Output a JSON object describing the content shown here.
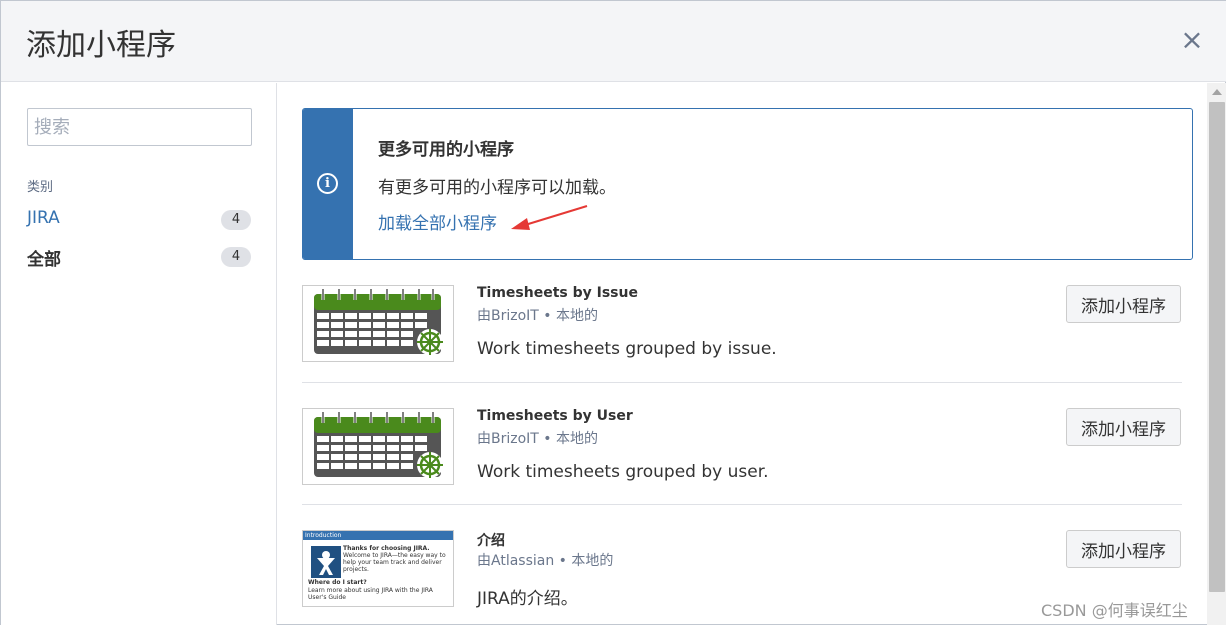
{
  "dialog": {
    "title": "添加小程序",
    "close_glyph": "×"
  },
  "sidebar": {
    "search_placeholder": "搜索",
    "category_heading": "类别",
    "categories": [
      {
        "label": "JIRA",
        "count": "4"
      },
      {
        "label": "全部",
        "count": "4"
      }
    ]
  },
  "info": {
    "icon": "info-icon",
    "title": "更多可用的小程序",
    "body": "有更多可用的小程序可以加载。",
    "link": "加载全部小程序"
  },
  "gadgets": [
    {
      "name": "Timesheets by Issue",
      "by": "由BrizoIT • 本地的",
      "description": "Work timesheets grouped by issue.",
      "button": "添加小程序",
      "thumbnail": "calendar-icon"
    },
    {
      "name": "Timesheets by User",
      "by": "由BrizoIT • 本地的",
      "description": "Work timesheets grouped by user.",
      "button": "添加小程序",
      "thumbnail": "calendar-icon"
    },
    {
      "name": "介绍",
      "by": "由Atlassian • 本地的",
      "description": "JIRA的介绍。",
      "button": "添加小程序",
      "thumbnail": "introduction-thumbnail",
      "thumb_text": {
        "bar": "Introduction",
        "line1": "Thanks for choosing JIRA.",
        "line2": "Welcome to JIRA—the easy way to help your team track and deliver projects.",
        "line3": "Where do I start?",
        "line4": "Learn more about using JIRA with the JIRA User's Guide"
      }
    }
  ],
  "colors": {
    "accent": "#3572b0",
    "calendar_green": "#4a8a1c",
    "calendar_grey": "#555555"
  },
  "watermark": "CSDN @何事误红尘"
}
